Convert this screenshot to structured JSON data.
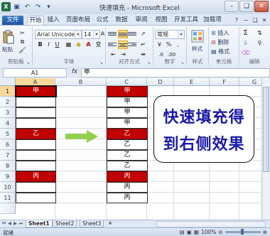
{
  "window": {
    "title": "快速填充 - Microsoft Excel",
    "qat": [
      "save-icon",
      "undo-icon",
      "redo-icon",
      "customize-icon"
    ]
  },
  "tabs": [
    {
      "label": "文件"
    },
    {
      "label": "开始"
    },
    {
      "label": "插入"
    },
    {
      "label": "页面布局"
    },
    {
      "label": "公式"
    },
    {
      "label": "数据"
    },
    {
      "label": "审阅"
    },
    {
      "label": "视图"
    },
    {
      "label": "开发工具"
    },
    {
      "label": "加载项"
    }
  ],
  "ribbon": {
    "clipboard": {
      "label": "剪贴板",
      "paste": "粘贴"
    },
    "font": {
      "label": "字体",
      "name": "Arial Unicode N",
      "size": "14",
      "bold": "B",
      "italic": "I",
      "underline": "U"
    },
    "alignment": {
      "label": "对齐方式"
    },
    "number": {
      "label": "数字",
      "format": "常规",
      "percent": "%",
      "comma": ","
    },
    "styles": {
      "label": "样式",
      "button": "样式"
    },
    "cells": {
      "label": "单元格",
      "insert": "插入",
      "delete": "删除",
      "format": "格式"
    },
    "editing": {
      "label": "编辑"
    }
  },
  "formula_bar": {
    "name_box": "A1",
    "fx": "fx",
    "content": "甲"
  },
  "sheet": {
    "columns": [
      "A",
      "B",
      "C",
      "D",
      "E",
      "F",
      "G"
    ],
    "rows": [
      "1",
      "2",
      "3",
      "4",
      "5",
      "6",
      "7",
      "8",
      "9",
      "10",
      "11"
    ],
    "left": [
      "甲",
      "",
      "",
      "",
      "乙",
      "",
      "",
      "",
      "丙",
      "",
      ""
    ],
    "right": [
      "甲",
      "甲",
      "甲",
      "甲",
      "乙",
      "乙",
      "乙",
      "乙",
      "丙",
      "丙",
      "丙"
    ],
    "callout": [
      "快速填充得",
      "到右侧效果"
    ]
  },
  "sheet_tabs": [
    "Sheet1",
    "Sheet2",
    "Sheet3"
  ],
  "status": {
    "ready": "就绪",
    "zoom": "100%"
  },
  "colors": {
    "highlight_red": "#c00000",
    "arrow_green": "#92d050",
    "callout_text": "#1a1aa8"
  }
}
